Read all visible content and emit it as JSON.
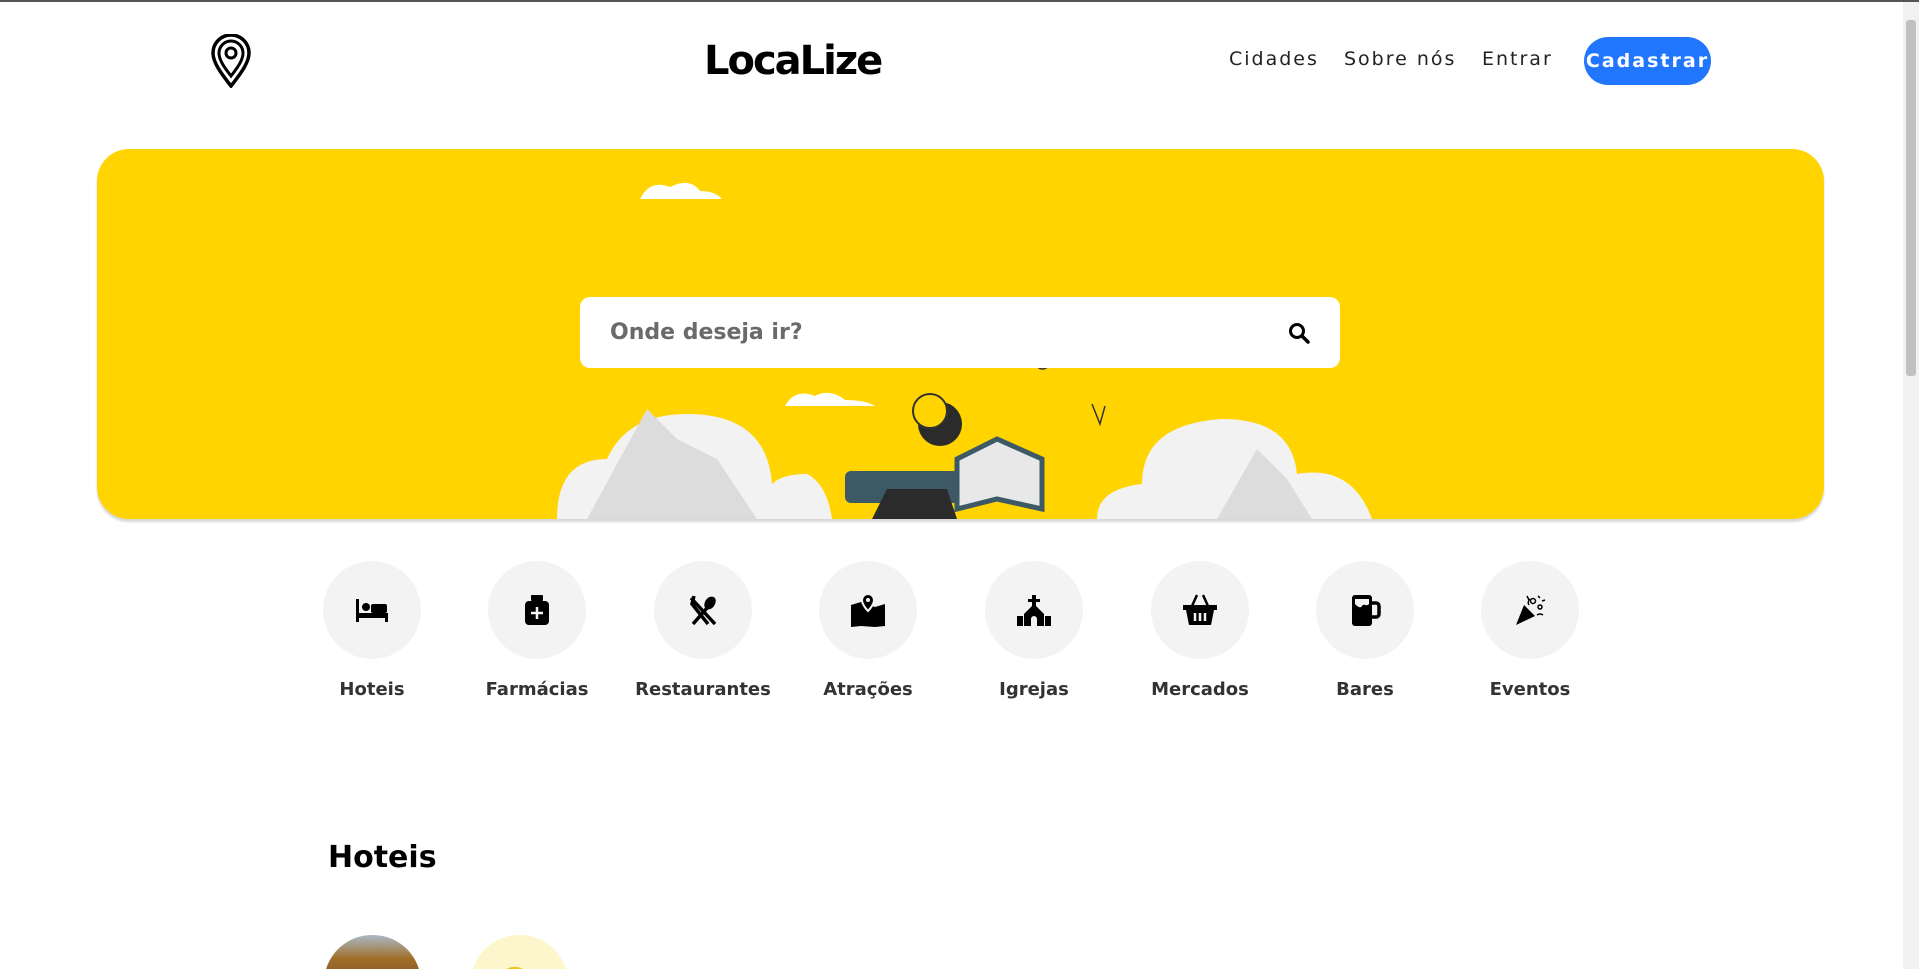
{
  "header": {
    "logo_text": "LocaLize",
    "nav": [
      "Cidades",
      "Sobre nós",
      "Entrar"
    ],
    "signup_label": "Cadastrar"
  },
  "hero": {
    "search_placeholder": "Onde deseja ir?"
  },
  "categories": [
    {
      "label": "Hoteis",
      "icon": "bed-icon"
    },
    {
      "label": "Farmácias",
      "icon": "medkit-icon"
    },
    {
      "label": "Restaurantes",
      "icon": "utensils-icon"
    },
    {
      "label": "Atrações",
      "icon": "map-marked-icon"
    },
    {
      "label": "Igrejas",
      "icon": "church-icon"
    },
    {
      "label": "Mercados",
      "icon": "basket-icon"
    },
    {
      "label": "Bares",
      "icon": "beer-icon"
    },
    {
      "label": "Eventos",
      "icon": "party-popper-icon"
    }
  ],
  "section": {
    "title": "Hoteis"
  },
  "colors": {
    "accent": "#2176ff",
    "hero": "#ffd400",
    "circle": "#f3f3f3"
  }
}
